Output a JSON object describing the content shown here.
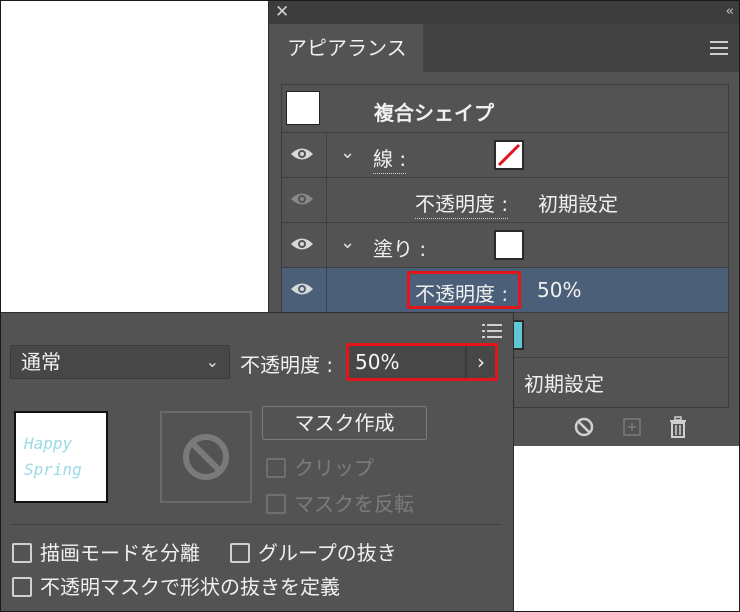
{
  "appearance_panel": {
    "tab": "アピアランス",
    "title": "複合シェイプ",
    "rows": [
      {
        "label": "線 :",
        "visible": true,
        "has_chevron": true,
        "swatch": "none-stroke"
      },
      {
        "label": "不透明度 :",
        "value": "初期設定",
        "visible": false
      },
      {
        "label": "塗り :",
        "visible": true,
        "has_chevron": true,
        "swatch": "white"
      },
      {
        "label": "不透明度 :",
        "value": "50%",
        "visible": true,
        "selected": true
      }
    ],
    "bottom_value": "初期設定",
    "fill_swatch_color": "#5fc7d6",
    "selected_color": "#4b6078"
  },
  "transparency_panel": {
    "blend_mode": "通常",
    "opacity_label": "不透明度 :",
    "opacity_value": "50%",
    "mask_button": "マスク作成",
    "clip_label": "クリップ",
    "invert_mask_label": "マスクを反転",
    "isolate_blending_label": "描画モードを分離",
    "knockout_group_label": "グループの抜き",
    "opacity_mask_label": "不透明マスクで形状の抜きを定義",
    "thumb_text": [
      "Happy",
      "Spring"
    ]
  },
  "highlight_color": "#e3141b"
}
